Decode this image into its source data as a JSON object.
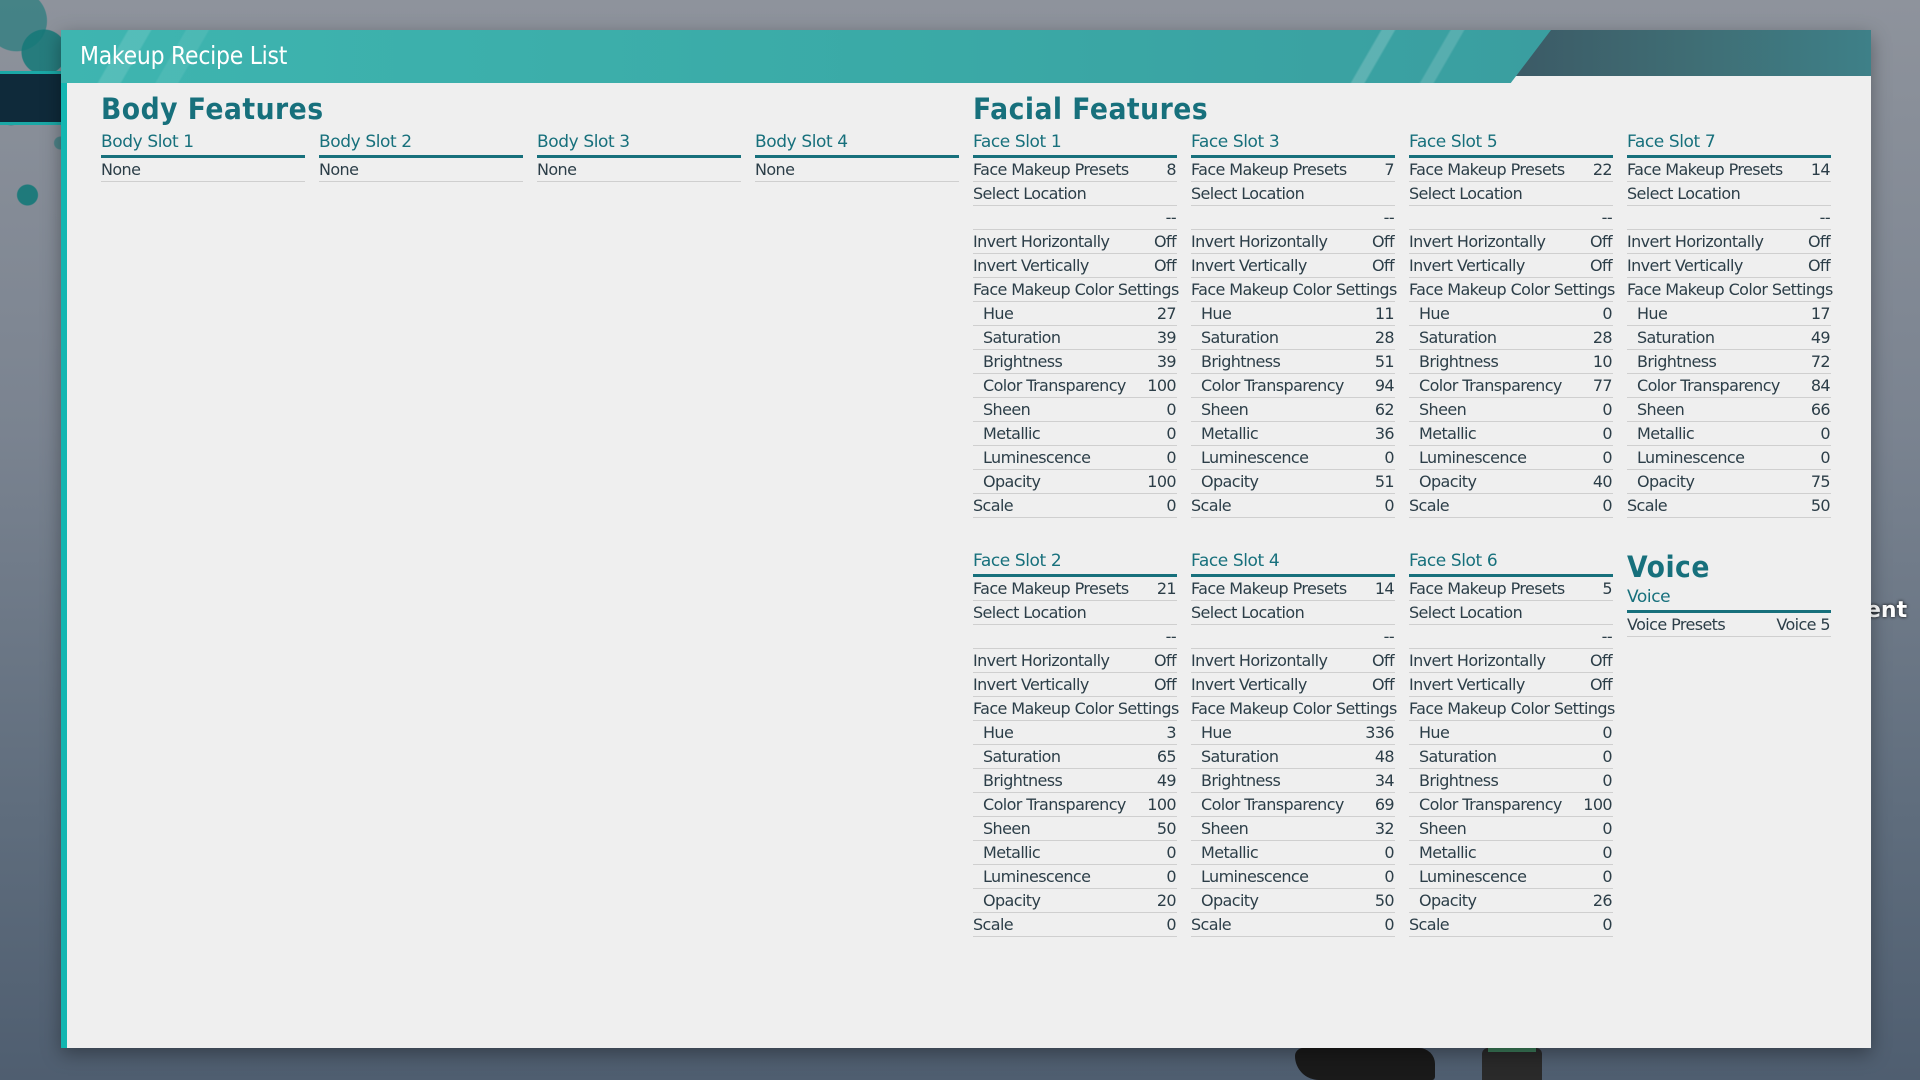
{
  "window": {
    "title": "Makeup Recipe List"
  },
  "background": {
    "partial_text": "ent"
  },
  "body_features": {
    "title": "Body Features",
    "slots": [
      {
        "name": "Body Slot 1",
        "value": "None"
      },
      {
        "name": "Body Slot 2",
        "value": "None"
      },
      {
        "name": "Body Slot 3",
        "value": "None"
      },
      {
        "name": "Body Slot 4",
        "value": "None"
      }
    ]
  },
  "facial_features": {
    "title": "Facial Features",
    "labels": {
      "presets": "Face Makeup Presets",
      "location": "Select Location",
      "invert_h": "Invert Horizontally",
      "invert_v": "Invert Vertically",
      "color_settings": "Face Makeup Color Settings",
      "hue": "Hue",
      "saturation": "Saturation",
      "brightness": "Brightness",
      "color_transparency": "Color Transparency",
      "sheen": "Sheen",
      "metallic": "Metallic",
      "luminescence": "Luminescence",
      "opacity": "Opacity",
      "scale": "Scale"
    },
    "slots": {
      "slot1": {
        "name": "Face Slot 1",
        "presets": "8",
        "location": "--",
        "invert_h": "Off",
        "invert_v": "Off",
        "hue": "27",
        "saturation": "39",
        "brightness": "39",
        "color_transparency": "100",
        "sheen": "0",
        "metallic": "0",
        "luminescence": "0",
        "opacity": "100",
        "scale": "0"
      },
      "slot3": {
        "name": "Face Slot 3",
        "presets": "7",
        "location": "--",
        "invert_h": "Off",
        "invert_v": "Off",
        "hue": "11",
        "saturation": "28",
        "brightness": "51",
        "color_transparency": "94",
        "sheen": "62",
        "metallic": "36",
        "luminescence": "0",
        "opacity": "51",
        "scale": "0"
      },
      "slot5": {
        "name": "Face Slot 5",
        "presets": "22",
        "location": "--",
        "invert_h": "Off",
        "invert_v": "Off",
        "hue": "0",
        "saturation": "28",
        "brightness": "10",
        "color_transparency": "77",
        "sheen": "0",
        "metallic": "0",
        "luminescence": "0",
        "opacity": "40",
        "scale": "0"
      },
      "slot7": {
        "name": "Face Slot 7",
        "presets": "14",
        "location": "--",
        "invert_h": "Off",
        "invert_v": "Off",
        "hue": "17",
        "saturation": "49",
        "brightness": "72",
        "color_transparency": "84",
        "sheen": "66",
        "metallic": "0",
        "luminescence": "0",
        "opacity": "75",
        "scale": "50"
      },
      "slot2": {
        "name": "Face Slot 2",
        "presets": "21",
        "location": "--",
        "invert_h": "Off",
        "invert_v": "Off",
        "hue": "3",
        "saturation": "65",
        "brightness": "49",
        "color_transparency": "100",
        "sheen": "50",
        "metallic": "0",
        "luminescence": "0",
        "opacity": "20",
        "scale": "0"
      },
      "slot4": {
        "name": "Face Slot 4",
        "presets": "14",
        "location": "--",
        "invert_h": "Off",
        "invert_v": "Off",
        "hue": "336",
        "saturation": "48",
        "brightness": "34",
        "color_transparency": "69",
        "sheen": "32",
        "metallic": "0",
        "luminescence": "0",
        "opacity": "50",
        "scale": "0"
      },
      "slot6": {
        "name": "Face Slot 6",
        "presets": "5",
        "location": "--",
        "invert_h": "Off",
        "invert_v": "Off",
        "hue": "0",
        "saturation": "0",
        "brightness": "0",
        "color_transparency": "100",
        "sheen": "0",
        "metallic": "0",
        "luminescence": "0",
        "opacity": "26",
        "scale": "0"
      }
    }
  },
  "voice": {
    "title": "Voice",
    "slot_name": "Voice",
    "presets_label": "Voice Presets",
    "presets_value": "Voice 5"
  },
  "colors": {
    "accent_teal": "#17707c",
    "header_teal": "#3eb5b0",
    "panel_bg": "#efefef"
  }
}
